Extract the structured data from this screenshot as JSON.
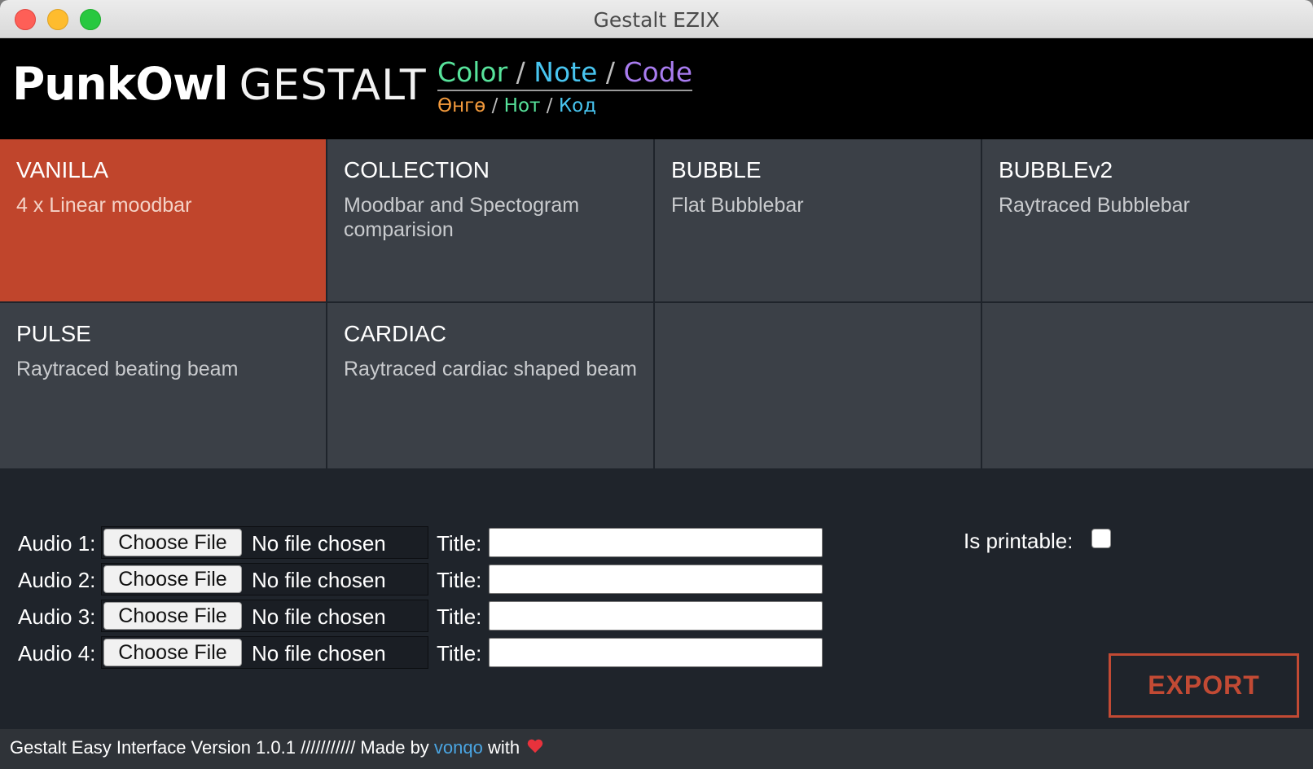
{
  "window": {
    "title": "Gestalt EZIX"
  },
  "header": {
    "brand_bold": "PunkOwl",
    "brand_light": "GESTALT",
    "tagline_en": [
      "Color",
      "Note",
      "Code"
    ],
    "tagline_ru": [
      "Өнгө",
      "Нот",
      "Код"
    ],
    "separator": " / "
  },
  "tiles": [
    {
      "name": "VANILLA",
      "desc": "4 x Linear moodbar",
      "active": true
    },
    {
      "name": "COLLECTION",
      "desc": "Moodbar and Spectogram comparision",
      "active": false
    },
    {
      "name": "BUBBLE",
      "desc": "Flat Bubblebar",
      "active": false
    },
    {
      "name": "BUBBLEv2",
      "desc": "Raytraced Bubblebar",
      "active": false
    },
    {
      "name": "PULSE",
      "desc": "Raytraced beating beam",
      "active": false
    },
    {
      "name": "CARDIAC",
      "desc": "Raytraced cardiac shaped beam",
      "active": false
    },
    {
      "name": "",
      "desc": "",
      "active": false
    },
    {
      "name": "",
      "desc": "",
      "active": false
    }
  ],
  "audio": [
    {
      "label": "Audio 1:",
      "button": "Choose File",
      "file": "No file chosen",
      "title_label": "Title:",
      "title_value": ""
    },
    {
      "label": "Audio 2:",
      "button": "Choose File",
      "file": "No file chosen",
      "title_label": "Title:",
      "title_value": ""
    },
    {
      "label": "Audio 3:",
      "button": "Choose File",
      "file": "No file chosen",
      "title_label": "Title:",
      "title_value": ""
    },
    {
      "label": "Audio 4:",
      "button": "Choose File",
      "file": "No file chosen",
      "title_label": "Title:",
      "title_value": ""
    }
  ],
  "options": {
    "printable_label": "Is printable:",
    "printable_checked": false
  },
  "actions": {
    "export_label": "EXPORT"
  },
  "footer": {
    "prefix": "Gestalt Easy Interface Version 1.0.1 /////////// Made by ",
    "author": "vonqo",
    "suffix": " with "
  },
  "colors": {
    "accent": "#c0452c",
    "tile": "#3b4047",
    "background": "#1f242b",
    "link": "#4aa5e2",
    "heart": "#e8323c"
  },
  "icons": [
    "close-window-icon",
    "minimize-window-icon",
    "maximize-window-icon",
    "heart-icon"
  ]
}
